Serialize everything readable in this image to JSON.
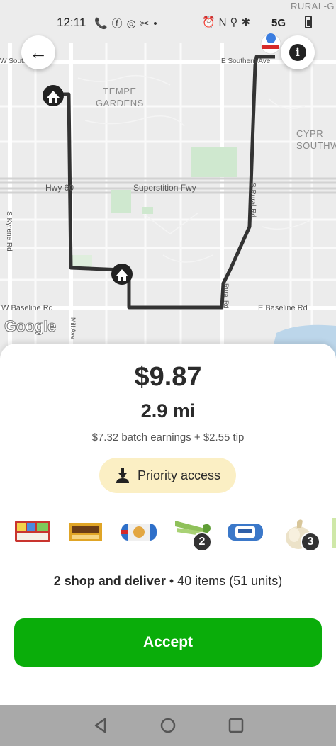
{
  "status_bar": {
    "time": "12:11",
    "left_icons": "📞ⓕ◎✂•",
    "right_icons": "⏰N⚲✱",
    "network": "5G",
    "icons": [
      "phone-icon",
      "facebook-icon",
      "instagram-icon",
      "tools-icon",
      "dot-icon",
      "alarm-icon",
      "nfc-icon",
      "location-icon",
      "bluetooth-icon",
      "signal-5g-icon",
      "battery-icon"
    ]
  },
  "map": {
    "labels": {
      "south_road_left": "W Southern Ave",
      "south_road_right": "E Southern Ave",
      "area_tempe": "TEMPE\nGARDENS",
      "area_cypress": "CYPR\nSOUTHW",
      "rural_top": "RURAL-G",
      "hwy60": "Hwy 60",
      "superstition": "Superstition Fwy",
      "rural_rd_upper": "S Rural Rd",
      "rural_rd_lower": "Rural Rd",
      "kyrene": "S Kyrene Rd",
      "baseline_left": "W Baseline Rd",
      "baseline_right": "E Baseline Rd",
      "mill_ave": "Mill Ave",
      "google": "Google"
    },
    "back_icon": "←",
    "info_icon": "i"
  },
  "offer": {
    "price": "$9.87",
    "distance": "2.9 mi",
    "earnings": "$7.32 batch earnings + $2.55 tip",
    "priority_label": "Priority access",
    "products": [
      {
        "name": "variety-pack",
        "color": "#c9342e",
        "badge": ""
      },
      {
        "name": "boxed-food",
        "color": "#e0a526",
        "badge": ""
      },
      {
        "name": "biscuit-can",
        "color": "#2e6fc9",
        "badge": ""
      },
      {
        "name": "celery",
        "color": "#8fc15a",
        "badge": "2"
      },
      {
        "name": "crescent-can",
        "color": "#3b78c9",
        "badge": ""
      },
      {
        "name": "onion",
        "color": "#e8dcc0",
        "badge": "3"
      }
    ],
    "summary_bold": "2 shop and deliver",
    "summary_rest": " • 40 items (51 units)",
    "accept_label": "Accept"
  },
  "navbar": {
    "icons": [
      "back-triangle-icon",
      "home-circle-icon",
      "recents-square-icon"
    ]
  }
}
